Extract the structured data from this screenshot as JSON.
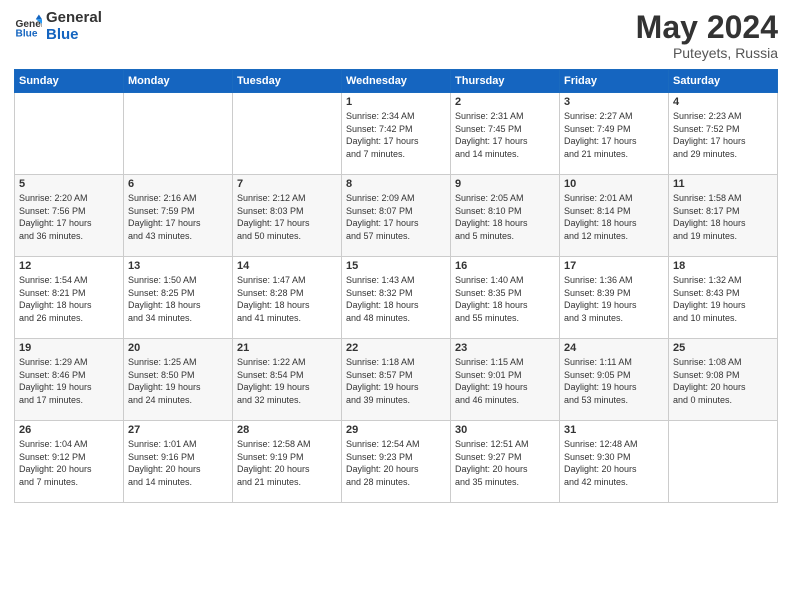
{
  "logo": {
    "text_general": "General",
    "text_blue": "Blue"
  },
  "title": "May 2024",
  "subtitle": "Puteyets, Russia",
  "days_header": [
    "Sunday",
    "Monday",
    "Tuesday",
    "Wednesday",
    "Thursday",
    "Friday",
    "Saturday"
  ],
  "weeks": [
    [
      {
        "day": "",
        "info": ""
      },
      {
        "day": "",
        "info": ""
      },
      {
        "day": "",
        "info": ""
      },
      {
        "day": "1",
        "info": "Sunrise: 2:34 AM\nSunset: 7:42 PM\nDaylight: 17 hours\nand 7 minutes."
      },
      {
        "day": "2",
        "info": "Sunrise: 2:31 AM\nSunset: 7:45 PM\nDaylight: 17 hours\nand 14 minutes."
      },
      {
        "day": "3",
        "info": "Sunrise: 2:27 AM\nSunset: 7:49 PM\nDaylight: 17 hours\nand 21 minutes."
      },
      {
        "day": "4",
        "info": "Sunrise: 2:23 AM\nSunset: 7:52 PM\nDaylight: 17 hours\nand 29 minutes."
      }
    ],
    [
      {
        "day": "5",
        "info": "Sunrise: 2:20 AM\nSunset: 7:56 PM\nDaylight: 17 hours\nand 36 minutes."
      },
      {
        "day": "6",
        "info": "Sunrise: 2:16 AM\nSunset: 7:59 PM\nDaylight: 17 hours\nand 43 minutes."
      },
      {
        "day": "7",
        "info": "Sunrise: 2:12 AM\nSunset: 8:03 PM\nDaylight: 17 hours\nand 50 minutes."
      },
      {
        "day": "8",
        "info": "Sunrise: 2:09 AM\nSunset: 8:07 PM\nDaylight: 17 hours\nand 57 minutes."
      },
      {
        "day": "9",
        "info": "Sunrise: 2:05 AM\nSunset: 8:10 PM\nDaylight: 18 hours\nand 5 minutes."
      },
      {
        "day": "10",
        "info": "Sunrise: 2:01 AM\nSunset: 8:14 PM\nDaylight: 18 hours\nand 12 minutes."
      },
      {
        "day": "11",
        "info": "Sunrise: 1:58 AM\nSunset: 8:17 PM\nDaylight: 18 hours\nand 19 minutes."
      }
    ],
    [
      {
        "day": "12",
        "info": "Sunrise: 1:54 AM\nSunset: 8:21 PM\nDaylight: 18 hours\nand 26 minutes."
      },
      {
        "day": "13",
        "info": "Sunrise: 1:50 AM\nSunset: 8:25 PM\nDaylight: 18 hours\nand 34 minutes."
      },
      {
        "day": "14",
        "info": "Sunrise: 1:47 AM\nSunset: 8:28 PM\nDaylight: 18 hours\nand 41 minutes."
      },
      {
        "day": "15",
        "info": "Sunrise: 1:43 AM\nSunset: 8:32 PM\nDaylight: 18 hours\nand 48 minutes."
      },
      {
        "day": "16",
        "info": "Sunrise: 1:40 AM\nSunset: 8:35 PM\nDaylight: 18 hours\nand 55 minutes."
      },
      {
        "day": "17",
        "info": "Sunrise: 1:36 AM\nSunset: 8:39 PM\nDaylight: 19 hours\nand 3 minutes."
      },
      {
        "day": "18",
        "info": "Sunrise: 1:32 AM\nSunset: 8:43 PM\nDaylight: 19 hours\nand 10 minutes."
      }
    ],
    [
      {
        "day": "19",
        "info": "Sunrise: 1:29 AM\nSunset: 8:46 PM\nDaylight: 19 hours\nand 17 minutes."
      },
      {
        "day": "20",
        "info": "Sunrise: 1:25 AM\nSunset: 8:50 PM\nDaylight: 19 hours\nand 24 minutes."
      },
      {
        "day": "21",
        "info": "Sunrise: 1:22 AM\nSunset: 8:54 PM\nDaylight: 19 hours\nand 32 minutes."
      },
      {
        "day": "22",
        "info": "Sunrise: 1:18 AM\nSunset: 8:57 PM\nDaylight: 19 hours\nand 39 minutes."
      },
      {
        "day": "23",
        "info": "Sunrise: 1:15 AM\nSunset: 9:01 PM\nDaylight: 19 hours\nand 46 minutes."
      },
      {
        "day": "24",
        "info": "Sunrise: 1:11 AM\nSunset: 9:05 PM\nDaylight: 19 hours\nand 53 minutes."
      },
      {
        "day": "25",
        "info": "Sunrise: 1:08 AM\nSunset: 9:08 PM\nDaylight: 20 hours\nand 0 minutes."
      }
    ],
    [
      {
        "day": "26",
        "info": "Sunrise: 1:04 AM\nSunset: 9:12 PM\nDaylight: 20 hours\nand 7 minutes."
      },
      {
        "day": "27",
        "info": "Sunrise: 1:01 AM\nSunset: 9:16 PM\nDaylight: 20 hours\nand 14 minutes."
      },
      {
        "day": "28",
        "info": "Sunrise: 12:58 AM\nSunset: 9:19 PM\nDaylight: 20 hours\nand 21 minutes."
      },
      {
        "day": "29",
        "info": "Sunrise: 12:54 AM\nSunset: 9:23 PM\nDaylight: 20 hours\nand 28 minutes."
      },
      {
        "day": "30",
        "info": "Sunrise: 12:51 AM\nSunset: 9:27 PM\nDaylight: 20 hours\nand 35 minutes."
      },
      {
        "day": "31",
        "info": "Sunrise: 12:48 AM\nSunset: 9:30 PM\nDaylight: 20 hours\nand 42 minutes."
      },
      {
        "day": "",
        "info": ""
      }
    ]
  ]
}
